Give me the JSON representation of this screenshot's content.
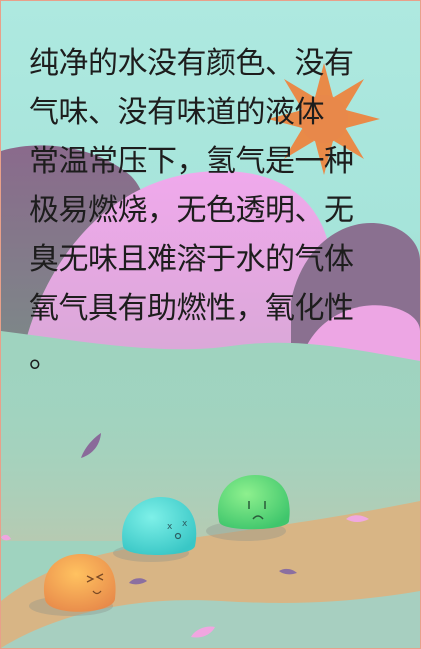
{
  "passage": {
    "lines": [
      "纯净的水没有颜色、没有",
      "气味、没有味道的液体",
      "常温常压下，氢气是一种",
      "极易燃烧，无色透明、无",
      "臭无味且难溶于水的气体",
      "氧气具有助燃性，氧化性",
      "。"
    ]
  },
  "scene": {
    "elements": [
      "sun-icon",
      "pink-hill",
      "purple-hill",
      "green-slime",
      "cyan-slime",
      "orange-slime",
      "falling-petal"
    ],
    "colors": {
      "sky": "#aee9e0",
      "sun": "#e8884a",
      "pink_hill": "#e9a6e6",
      "purple_hill": "#8d6e8e",
      "green_slime": "#5fd57a",
      "cyan_slime": "#4fd9d0",
      "orange_slime": "#f2a04a",
      "sand": "#d9b585"
    }
  }
}
